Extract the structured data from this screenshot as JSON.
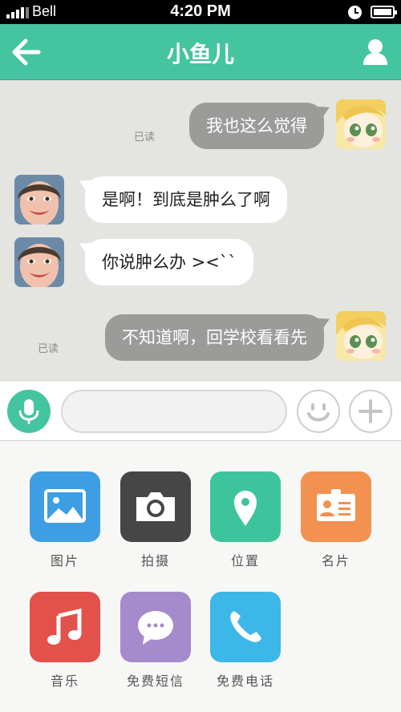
{
  "status_bar": {
    "carrier": "Bell",
    "time": "4:20 PM"
  },
  "header": {
    "title": "小鱼儿"
  },
  "messages": [
    {
      "direction": "out",
      "text": "我也这么觉得",
      "status": "已读"
    },
    {
      "direction": "in",
      "text": "是啊！到底是肿么了啊"
    },
    {
      "direction": "in",
      "text": "你说肿么办 ><``"
    },
    {
      "direction": "out",
      "text": "不知道啊，回学校看看先",
      "status": "已读"
    }
  ],
  "input": {
    "value": "",
    "placeholder": ""
  },
  "apps": [
    {
      "label": "图片",
      "icon": "image-icon",
      "color": "#3e9ee3"
    },
    {
      "label": "拍摄",
      "icon": "camera-icon",
      "color": "#464646"
    },
    {
      "label": "位置",
      "icon": "location-pin-icon",
      "color": "#3ec49c"
    },
    {
      "label": "名片",
      "icon": "contact-card-icon",
      "color": "#f39150"
    },
    {
      "label": "音乐",
      "icon": "music-note-icon",
      "color": "#e2514a"
    },
    {
      "label": "免费短信",
      "icon": "chat-bubble-icon",
      "color": "#a58bcb"
    },
    {
      "label": "免费电话",
      "icon": "phone-icon",
      "color": "#3db6e8"
    }
  ],
  "colors": {
    "accent": "#45c4a0",
    "chat_bg": "#e4e4e1",
    "outgoing_bubble": "#9b9c9a"
  }
}
